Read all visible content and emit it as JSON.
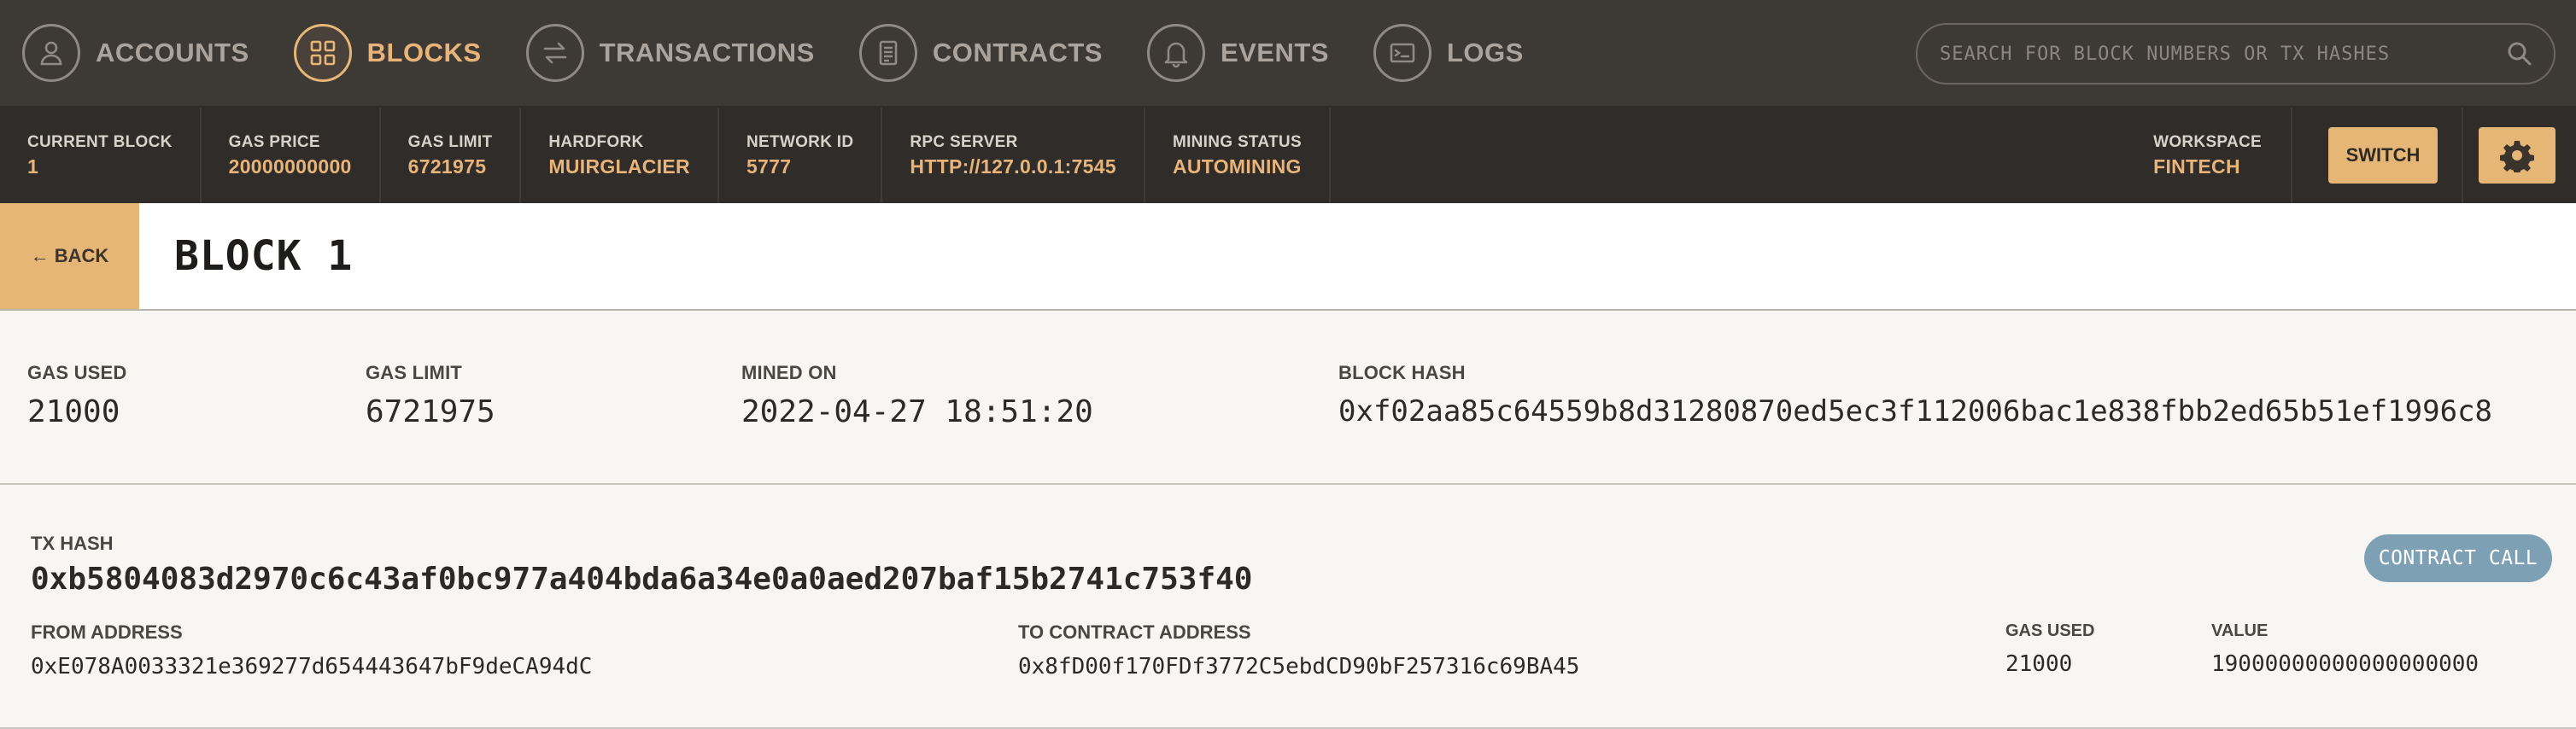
{
  "nav": {
    "items": [
      {
        "label": "ACCOUNTS",
        "icon": "user-icon",
        "active": false
      },
      {
        "label": "BLOCKS",
        "icon": "grid-icon",
        "active": true
      },
      {
        "label": "TRANSACTIONS",
        "icon": "swap-arrows-icon",
        "active": false
      },
      {
        "label": "CONTRACTS",
        "icon": "document-icon",
        "active": false
      },
      {
        "label": "EVENTS",
        "icon": "bell-icon",
        "active": false
      },
      {
        "label": "LOGS",
        "icon": "terminal-icon",
        "active": false
      }
    ],
    "search_placeholder": "SEARCH FOR BLOCK NUMBERS OR TX HASHES"
  },
  "status": {
    "current_block": {
      "label": "CURRENT BLOCK",
      "value": "1"
    },
    "gas_price": {
      "label": "GAS PRICE",
      "value": "20000000000"
    },
    "gas_limit": {
      "label": "GAS LIMIT",
      "value": "6721975"
    },
    "hardfork": {
      "label": "HARDFORK",
      "value": "MUIRGLACIER"
    },
    "network_id": {
      "label": "NETWORK ID",
      "value": "5777"
    },
    "rpc_server": {
      "label": "RPC SERVER",
      "value": "HTTP://127.0.0.1:7545"
    },
    "mining_status": {
      "label": "MINING STATUS",
      "value": "AUTOMINING"
    },
    "workspace": {
      "label": "WORKSPACE",
      "value": "FINTECH"
    },
    "switch_label": "SWITCH"
  },
  "title": {
    "back_label": "← BACK",
    "text": "BLOCK 1"
  },
  "block": {
    "gas_used": {
      "label": "GAS USED",
      "value": "21000"
    },
    "gas_limit": {
      "label": "GAS LIMIT",
      "value": "6721975"
    },
    "mined_on": {
      "label": "MINED ON",
      "value": "2022-04-27 18:51:20"
    },
    "block_hash": {
      "label": "BLOCK HASH",
      "value": "0xf02aa85c64559b8d31280870ed5ec3f112006bac1e838fbb2ed65b51ef1996c8"
    }
  },
  "tx": {
    "hash_label": "TX HASH",
    "hash": "0xb5804083d2970c6c43af0bc977a404bda6a34e0a0aed207baf15b2741c753f40",
    "type_badge": "CONTRACT CALL",
    "from": {
      "label": "FROM ADDRESS",
      "value": "0xE078A0033321e369277d654443647bF9deCA94dC"
    },
    "to": {
      "label": "TO CONTRACT ADDRESS",
      "value": "0x8fD00f170FDf3772C5ebdCD90bF257316c69BA45"
    },
    "gas_used": {
      "label": "GAS USED",
      "value": "21000"
    },
    "value": {
      "label": "VALUE",
      "value": "19000000000000000000"
    }
  },
  "colors": {
    "accent": "#e6b677",
    "nav_bg": "#3d3935",
    "status_bg": "#2f2c29",
    "badge": "#7ea0b5"
  }
}
